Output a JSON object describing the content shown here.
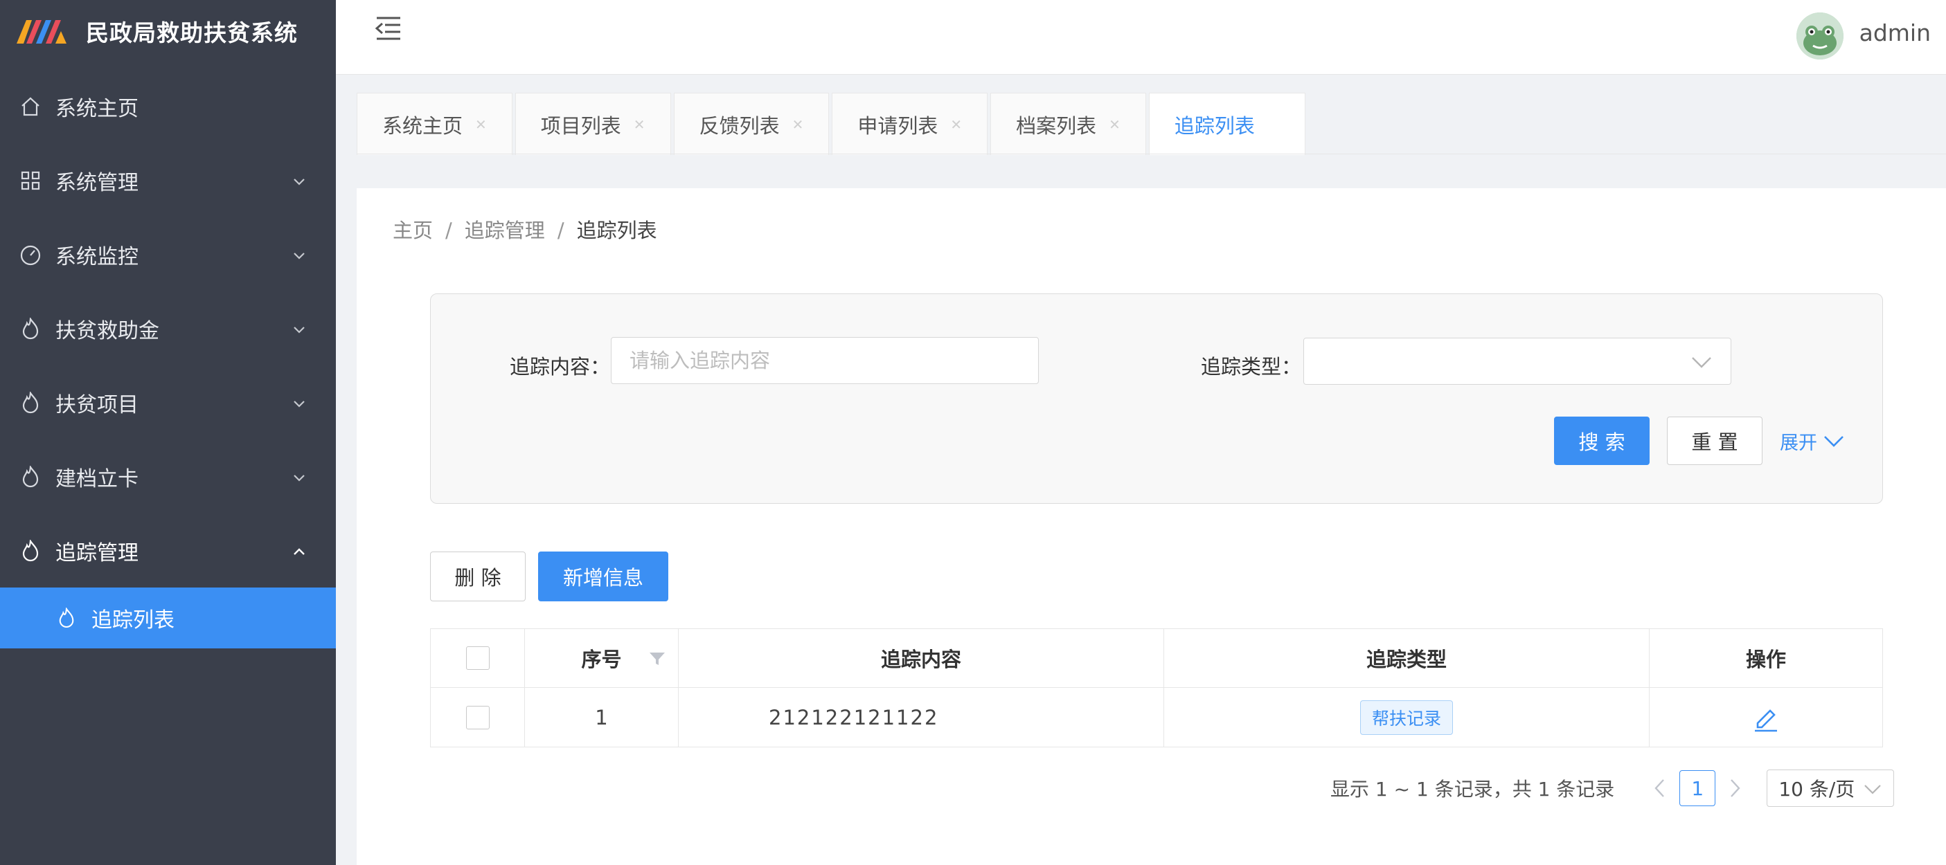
{
  "app": {
    "title": "民政局救助扶贫系统",
    "username": "admin",
    "accent_color": "#3b8ff3",
    "sidebar_color": "#3a3f4b"
  },
  "sidebar": {
    "items": [
      {
        "label": "系统主页",
        "icon": "home-icon"
      },
      {
        "label": "系统管理",
        "icon": "grid-icon"
      },
      {
        "label": "系统监控",
        "icon": "dashboard-icon"
      },
      {
        "label": "扶贫救助金",
        "icon": "flame-icon"
      },
      {
        "label": "扶贫项目",
        "icon": "flame-icon"
      },
      {
        "label": "建档立卡",
        "icon": "flame-icon"
      },
      {
        "label": "追踪管理",
        "icon": "flame-icon",
        "expanded": true
      }
    ],
    "sub_items": [
      {
        "label": "追踪列表",
        "icon": "flame-icon",
        "active": true
      }
    ]
  },
  "tabs": [
    {
      "label": "系统主页",
      "active": false
    },
    {
      "label": "项目列表",
      "active": false
    },
    {
      "label": "反馈列表",
      "active": false
    },
    {
      "label": "申请列表",
      "active": false
    },
    {
      "label": "档案列表",
      "active": false
    },
    {
      "label": "追踪列表",
      "active": true
    }
  ],
  "breadcrumb": [
    "主页",
    "追踪管理",
    "追踪列表"
  ],
  "search": {
    "content_label": "追踪内容",
    "content_placeholder": "请输入追踪内容",
    "content_value": "",
    "type_label": "追踪类型",
    "type_value": "",
    "search_button": "搜 索",
    "reset_button": "重 置",
    "expand_link": "展开"
  },
  "toolbar": {
    "delete_button": "删 除",
    "add_button": "新增信息"
  },
  "table": {
    "headers": [
      "序号",
      "追踪内容",
      "追踪类型",
      "操作"
    ],
    "rows": [
      {
        "index": "1",
        "content": "212122121122",
        "type": "帮扶记录"
      }
    ]
  },
  "pagination": {
    "summary": "显示 1 ~ 1 条记录，共 1 条记录",
    "current_page": "1",
    "page_size": "10 条/页"
  }
}
